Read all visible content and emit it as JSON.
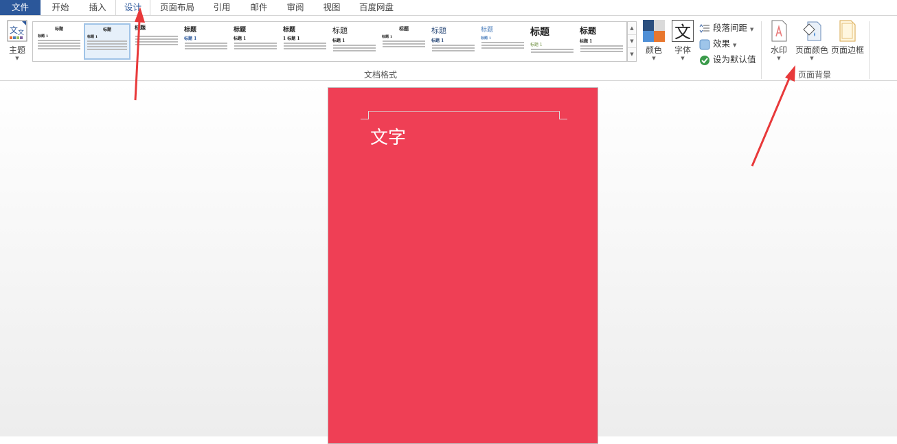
{
  "tabs": [
    "文件",
    "开始",
    "插入",
    "设计",
    "页面布局",
    "引用",
    "邮件",
    "审阅",
    "视图",
    "百度网盘"
  ],
  "ribbon": {
    "theme_label": "主题",
    "gallery_thumbs": [
      {
        "title": "标题",
        "heading": "标题 1"
      },
      {
        "title": "标题",
        "heading": "标题 1"
      },
      {
        "title": "标题",
        "heading": ""
      },
      {
        "title": "标题",
        "heading": "标题 1"
      },
      {
        "title": "标题",
        "heading": "标题 1"
      },
      {
        "title": "标题",
        "heading": "1 标题 1"
      },
      {
        "title": "标题",
        "heading": "标题 1"
      },
      {
        "title": "标题",
        "heading": "标题 1"
      },
      {
        "title": "标题",
        "heading": "标题 1"
      },
      {
        "title": "标题",
        "heading": "标题 1"
      },
      {
        "title": "标题",
        "heading": "标题 1"
      },
      {
        "title": "标题",
        "heading": "标题 1"
      }
    ],
    "doc_format_group": "文档格式",
    "colors_label": "颜色",
    "fonts_label": "字体",
    "paragraph_spacing": "段落间距",
    "effects": "效果",
    "set_default": "设为默认值",
    "watermark": "水印",
    "page_color": "页面颜色",
    "page_borders": "页面边框",
    "page_background_group": "页面背景"
  },
  "document": {
    "text": "文字",
    "page_color": "#ef3f55"
  },
  "colors": {
    "accent": "#2b579a",
    "arrow": "#e8393a"
  }
}
